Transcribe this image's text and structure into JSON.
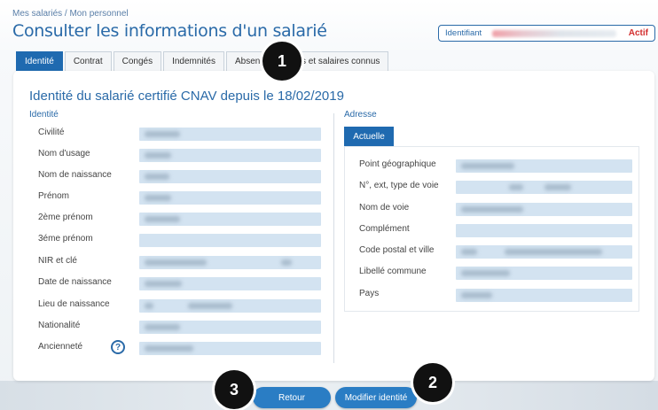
{
  "header": {
    "breadcrumb": "Mes salariés / Mon personnel",
    "title": "Consulter les informations d'un salarié",
    "identifier_label": "Identifiant",
    "status": "Actif"
  },
  "tabs": [
    {
      "label": "Identité",
      "active": true
    },
    {
      "label": "Contrat",
      "active": false
    },
    {
      "label": "Congés",
      "active": false
    },
    {
      "label": "Indemnités",
      "active": false
    },
    {
      "label": "Absences",
      "visible_text": "Absenc",
      "active": false
    },
    {
      "label": "…s et salaires connus",
      "visible_text": "s et salaires connus",
      "active": false
    }
  ],
  "identity": {
    "section_title": "Identité du salarié certifié CNAV depuis le 18/02/2019",
    "left_label": "Identité",
    "fields": [
      {
        "label": "Civilité"
      },
      {
        "label": "Nom d'usage"
      },
      {
        "label": "Nom de naissance"
      },
      {
        "label": "Prénom"
      },
      {
        "label": "2ème prénom"
      },
      {
        "label": "3éme prénom"
      },
      {
        "label": "NIR et clé"
      },
      {
        "label": "Date de naissance"
      },
      {
        "label": "Lieu de naissance"
      },
      {
        "label": "Nationalité"
      },
      {
        "label": "Ancienneté"
      }
    ],
    "help_icon": "question-circle-icon"
  },
  "address": {
    "label": "Adresse",
    "tab": "Actuelle",
    "fields": [
      {
        "label": "Point géographique"
      },
      {
        "label": "N°, ext, type de voie"
      },
      {
        "label": "Nom de voie"
      },
      {
        "label": "Complément"
      },
      {
        "label": "Code postal et ville"
      },
      {
        "label": "Libellé commune"
      },
      {
        "label": "Pays"
      }
    ]
  },
  "buttons": {
    "back": "Retour",
    "edit": "Modifier identité"
  },
  "callouts": [
    "1",
    "2",
    "3"
  ],
  "colors": {
    "accent": "#1f6ab0",
    "title": "#2a6aa8",
    "status": "#d32f2f",
    "field_bg": "#d3e3f1"
  }
}
